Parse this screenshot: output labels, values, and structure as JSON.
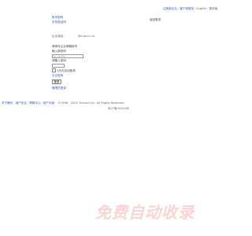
{
  "header": {
    "nav": [
      "注册新企业",
      "客户端登录",
      "English",
      "繁体版"
    ],
    "return_link": "返回登录"
  },
  "tabs": [
    "帐号密码",
    "手机验证码"
  ],
  "domain_row": {
    "label": "企业域名:",
    "value": "@a.bnnn.co"
  },
  "form": {
    "instructions": "请填写企业邮箱帐号",
    "password_label": "输入新密码",
    "password_placeholder": "输入新密码",
    "confirm_label": "请输入密码",
    "remember_label": "1天内自动登录",
    "forgot_link": "忘记密码",
    "submit_label": "登录",
    "manage_link": "管理员登录"
  },
  "footer": {
    "links": [
      "关于腾讯",
      "用户协议",
      "帮助中心",
      "用户手册"
    ],
    "copyright": "©1998 - 2024 Tencent Inc. All Rights Reserved",
    "icp": "粤ICP备05061B号"
  },
  "watermark": "免费自动收录",
  "colors": {
    "link": "#2a56c6",
    "watermark": "#fad4d4"
  }
}
